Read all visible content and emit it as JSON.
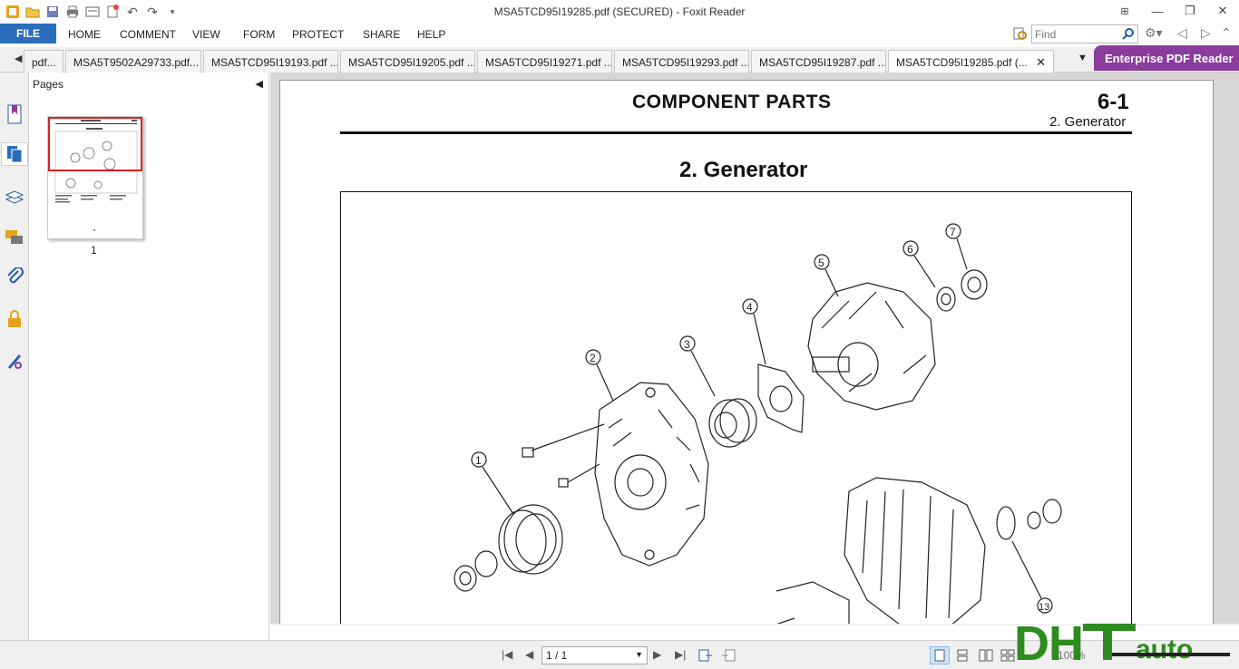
{
  "window": {
    "title": "MSA5TCD95I19285.pdf (SECURED) - Foxit Reader"
  },
  "menu": {
    "file": "FILE",
    "items": [
      "HOME",
      "COMMENT",
      "VIEW",
      "FORM",
      "PROTECT",
      "SHARE",
      "HELP"
    ],
    "find_placeholder": "Find"
  },
  "tabs": [
    {
      "label": "pdf..."
    },
    {
      "label": "MSA5T9502A29733.pdf..."
    },
    {
      "label": "MSA5TCD95I19193.pdf ..."
    },
    {
      "label": "MSA5TCD95I19205.pdf ..."
    },
    {
      "label": "MSA5TCD95I19271.pdf ..."
    },
    {
      "label": "MSA5TCD95I19293.pdf ..."
    },
    {
      "label": "MSA5TCD95I19287.pdf ..."
    },
    {
      "label": "MSA5TCD95I19285.pdf (...",
      "active": true
    }
  ],
  "enterprise_label": "Enterprise PDF Reader",
  "pages_panel": {
    "title": "Pages",
    "thumbnail_label": "1"
  },
  "document": {
    "header": "COMPONENT PARTS",
    "page_number": "6-1",
    "subheader": "2. Generator",
    "section_title": "2.  Generator",
    "callouts": [
      "1",
      "2",
      "3",
      "4",
      "5",
      "6",
      "7",
      "13"
    ]
  },
  "status": {
    "page_indicator": "1 / 1",
    "zoom": "100%"
  },
  "watermark": {
    "text": "DHTauto"
  },
  "colors": {
    "file_menu_bg": "#2a6ebb",
    "enterprise_bg": "#8a3d9c",
    "thumb_highlight": "#e02020",
    "watermark_green": "#2e8b1f"
  }
}
